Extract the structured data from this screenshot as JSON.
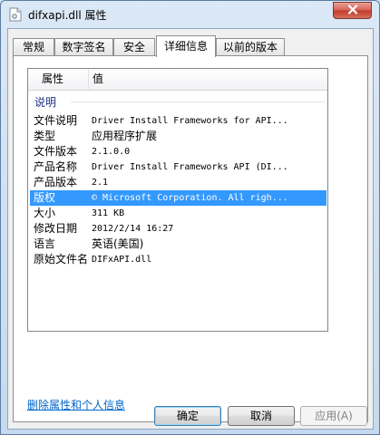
{
  "window": {
    "title": "difxapi.dll 属性",
    "icon": "dll-file-icon",
    "close_icon": "close-icon"
  },
  "tabs": [
    {
      "label": "常规",
      "active": false
    },
    {
      "label": "数字签名",
      "active": false
    },
    {
      "label": "安全",
      "active": false
    },
    {
      "label": "详细信息",
      "active": true
    },
    {
      "label": "以前的版本",
      "active": false
    }
  ],
  "list": {
    "headers": {
      "property": "属性",
      "value": "值"
    },
    "group": "说明",
    "rows": [
      {
        "name": "文件说明",
        "value": "Driver Install Frameworks for API..."
      },
      {
        "name": "类型",
        "value": "应用程序扩展"
      },
      {
        "name": "文件版本",
        "value": "2.1.0.0"
      },
      {
        "name": "产品名称",
        "value": "Driver Install Frameworks API (DI..."
      },
      {
        "name": "产品版本",
        "value": "2.1"
      },
      {
        "name": "版权",
        "value": "© Microsoft Corporation. All righ...",
        "selected": true
      },
      {
        "name": "大小",
        "value": "311 KB"
      },
      {
        "name": "修改日期",
        "value": "2012/2/14 16:27"
      },
      {
        "name": "语言",
        "value": "英语(美国)"
      },
      {
        "name": "原始文件名",
        "value": "DIFxAPI.dll"
      }
    ]
  },
  "link": {
    "remove_properties": "删除属性和个人信息"
  },
  "buttons": {
    "ok": "确定",
    "cancel": "取消",
    "apply": "应用(A)"
  },
  "colors": {
    "selection": "#3399ff",
    "link": "#0066cc",
    "group_text": "#1e3287"
  }
}
